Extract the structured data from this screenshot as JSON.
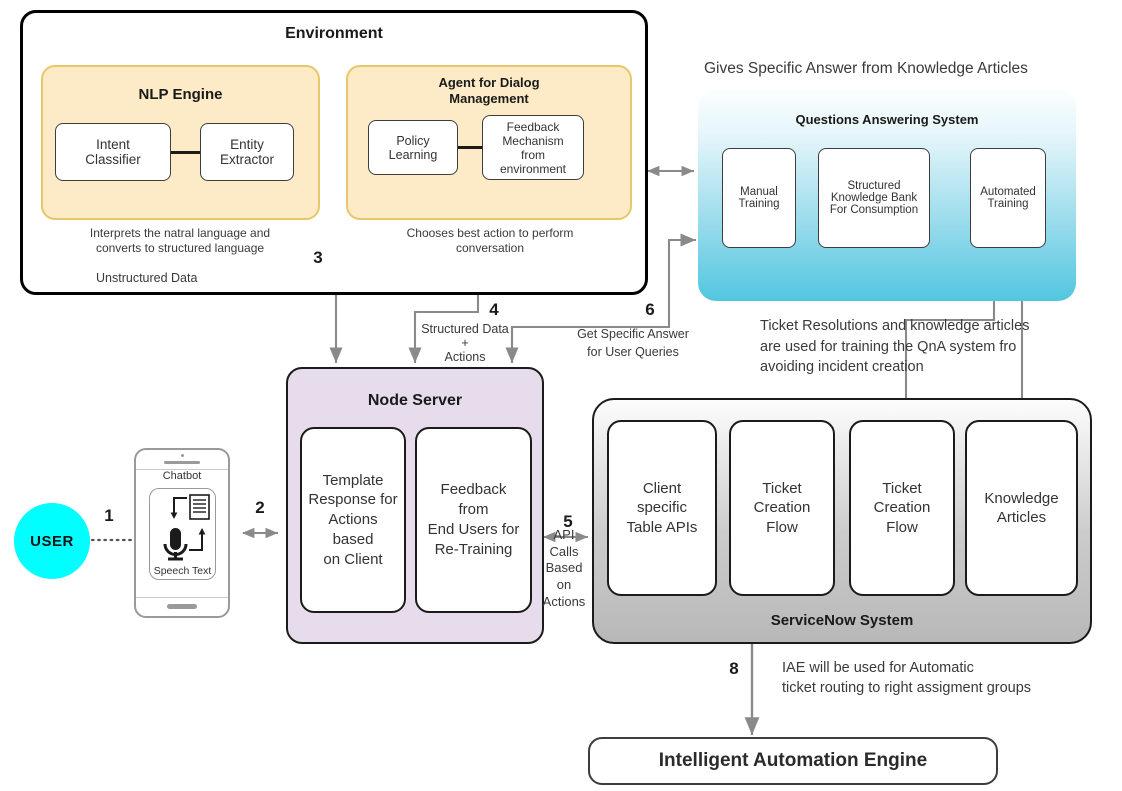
{
  "environment": {
    "title": "Environment",
    "nlp_engine": {
      "title": "NLP Engine",
      "boxes": [
        {
          "label": "Intent\nClassifier"
        },
        {
          "label": "Entity\nExtractor"
        }
      ],
      "caption": "Interprets the natral language and\nconverts to structured language"
    },
    "dialog_agent": {
      "title": "Agent for Dialog\nManagement",
      "boxes": [
        {
          "label": "Policy\nLearning"
        },
        {
          "label": "Feedback\nMechanism\nfrom\nenvironment"
        }
      ],
      "caption": "Chooses best action to perform\nconversation"
    },
    "unstructured_data_label": "Unstructured Data"
  },
  "qna": {
    "headline": "Gives Specific Answer from Knowledge Articles",
    "title": "Questions Answering System",
    "boxes": [
      {
        "label": "Manual\nTraining"
      },
      {
        "label": "Structured\nKnowledge Bank\nFor Consumption"
      },
      {
        "label": "Automated\nTraining"
      }
    ]
  },
  "node_server": {
    "title": "Node Server",
    "boxes": [
      {
        "label": "Template\nResponse for\nActions\nbased\non Client"
      },
      {
        "label": "Feedback\nfrom\nEnd Users for\nRe-Training"
      }
    ]
  },
  "servicenow": {
    "title": "ServiceNow System",
    "boxes": [
      {
        "label": "Client\nspecific\nTable APIs"
      },
      {
        "label": "Ticket\nCreation\nFlow"
      },
      {
        "label": "Ticket\nCreation\nFlow"
      },
      {
        "label": "Knowledge\nArticles"
      }
    ]
  },
  "iae": {
    "title": "Intelligent Automation Engine"
  },
  "user": {
    "label": "USER"
  },
  "phone": {
    "app_label": "Chatbot",
    "screen_label": "Speech Text"
  },
  "steps": {
    "s1": "1",
    "s2": "2",
    "s3": "3",
    "s4": "4",
    "s5": "5",
    "s6": "6",
    "s8": "8"
  },
  "annotations": {
    "structured_data_actions": "Structured Data\n+\nActions",
    "get_specific_answer": "Get Specific Answer\nfor User Queries",
    "api_calls": "API\nCalls\nBased\non\nActions",
    "ticket_resolutions": "Ticket Resolutions and knowledge articles\nare used for training the QnA system fro\navoiding incident creation",
    "iae_routing": "IAE will be used for Automatic\nticket routing to right assigment groups"
  },
  "colors": {
    "user_circle": "#00FFFF",
    "nlp_panel": "#FCEBC6",
    "nlp_border": "#E8C66A",
    "node_server": "#E6DCEC",
    "qna_bottom": "#52C6E0",
    "servicenow_bottom": "#B8B8B8",
    "arrow": "#808080",
    "outline": "#000000"
  }
}
